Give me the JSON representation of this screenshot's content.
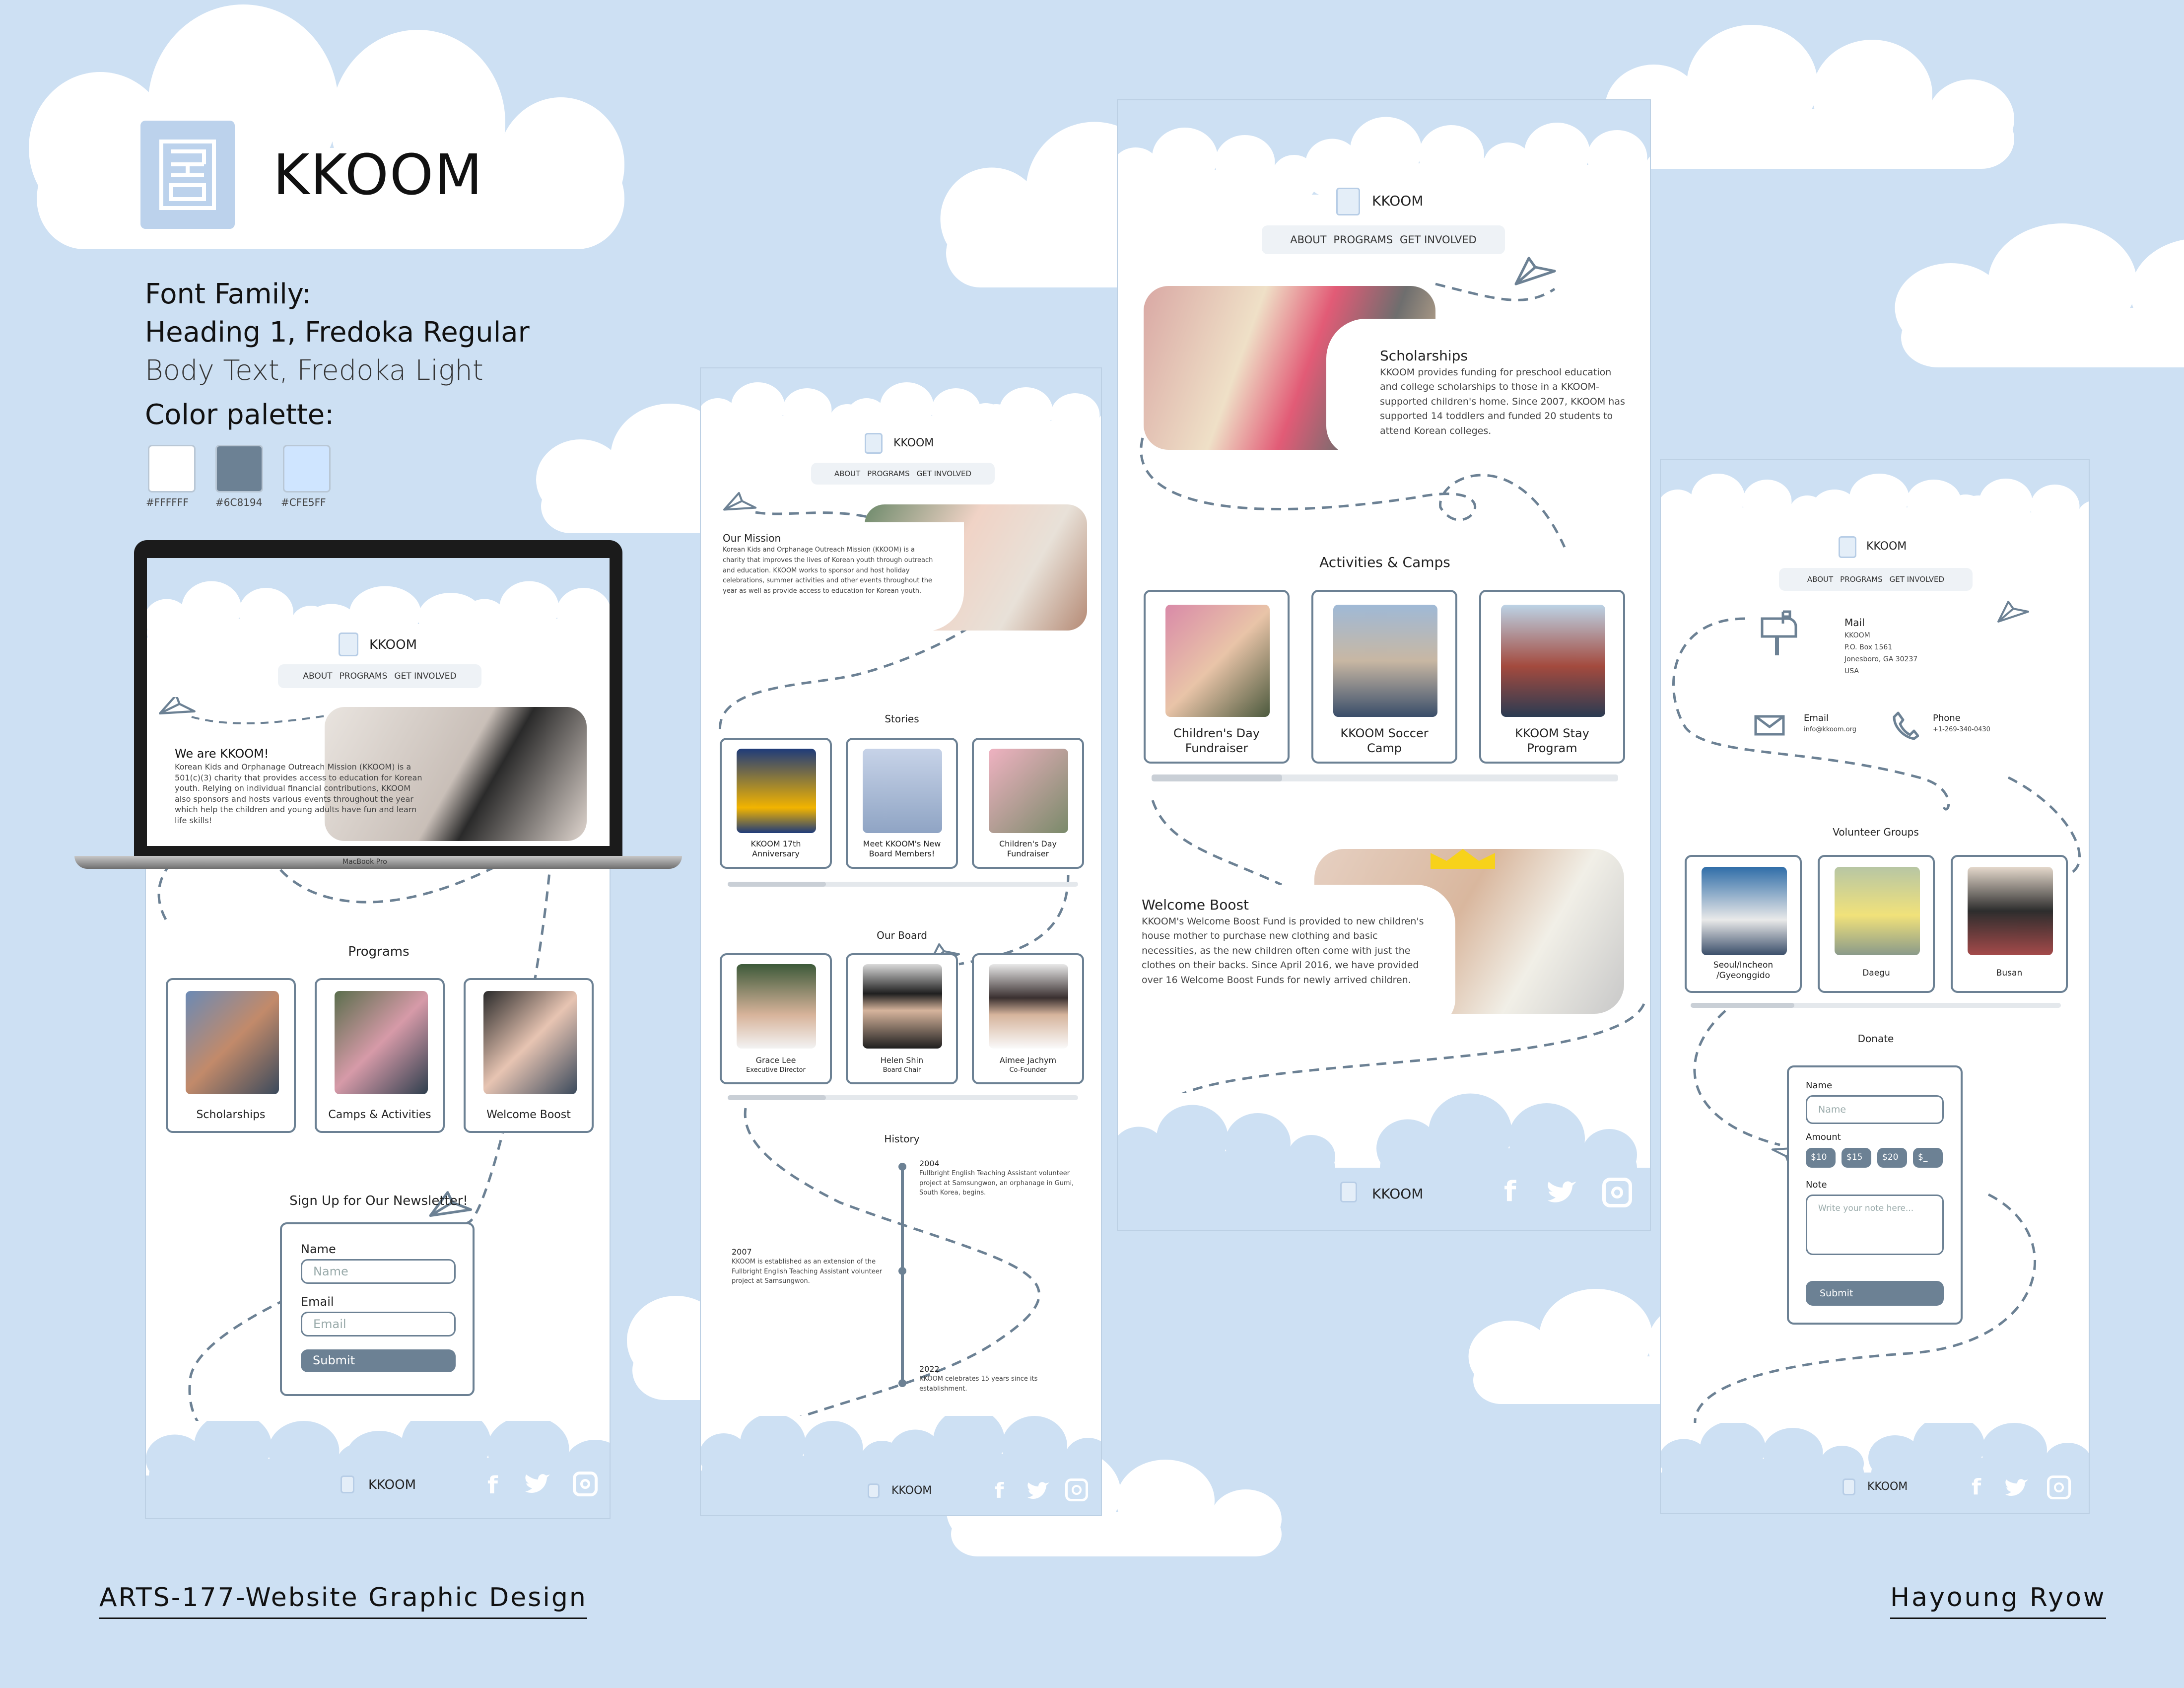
{
  "brand": {
    "name": "KKOOM"
  },
  "style_guide": {
    "font_family_label": "Font Family:",
    "heading_line": "Heading 1, Fredoka Regular",
    "body_line": "Body Text, Fredoka Light",
    "palette_label": "Color palette:",
    "colors": [
      {
        "hex": "#FFFFFF",
        "label": "#FFFFFF"
      },
      {
        "hex": "#6C8194",
        "label": "#6C8194"
      },
      {
        "hex": "#CFE5FF",
        "label": "#CFE5FF"
      }
    ]
  },
  "nav": {
    "about": "ABOUT",
    "programs": "PROGRAMS",
    "get_involved": "GET INVOLVED"
  },
  "home": {
    "hero_title": "We are KKOOM!",
    "hero_body": "Korean Kids and Orphanage Outreach Mission (KKOOM) is a 501(c)(3) charity that provides access to education for Korean youth. Relying on individual financial contributions, KKOOM also sponsors and hosts various events throughout the year which help the children and young adults have fun and learn life skills!",
    "laptop_label": "MacBook Pro",
    "programs_title": "Programs",
    "programs": [
      "Scholarships",
      "Camps & Activities",
      "Welcome Boost"
    ],
    "newsletter_title": "Sign Up for Our Newsletter!",
    "name_label": "Name",
    "name_placeholder": "Name",
    "email_label": "Email",
    "email_placeholder": "Email",
    "submit": "Submit"
  },
  "about": {
    "mission_title": "Our Mission",
    "mission_body": "Korean Kids and Orphanage Outreach Mission (KKOOM) is a charity that improves the lives of Korean youth through outreach and education. KKOOM works to sponsor and host holiday celebrations, summer activities and other events throughout the year as well as provide access to education for Korean youth.",
    "stories_title": "Stories",
    "stories": [
      "KKOOM 17th Anniversary",
      "Meet KKOOM's New Board Members!",
      "Children's Day Fundraiser"
    ],
    "board_title": "Our Board",
    "board": [
      {
        "name": "Grace Lee",
        "role": "Executive Director"
      },
      {
        "name": "Helen Shin",
        "role": "Board Chair"
      },
      {
        "name": "Aimee Jachym",
        "role": "Co-Founder"
      }
    ],
    "history_title": "History",
    "history": [
      {
        "year": "2004",
        "text": "Fullbright English Teaching Assistant volunteer project at Samsungwon, an orphanage in Gumi, South Korea, begins."
      },
      {
        "year": "2007",
        "text": "KKOOM is established as an extension of the Fullbright English Teaching Assistant volunteer project at Samsungwon."
      },
      {
        "year": "2022",
        "text": "KKOOM celebrates 15 years since its establishment."
      }
    ]
  },
  "programs_page": {
    "scholarships_title": "Scholarships",
    "scholarships_body": "KKOOM provides funding for preschool education and college scholarships to those in a KKOOM-supported children's home. Since 2007, KKOOM has supported 14 toddlers and funded 20 students to attend Korean colleges.",
    "activities_title": "Activities & Camps",
    "activities": [
      "Children's Day Fundraiser",
      "KKOOM Soccer Camp",
      "KKOOM Stay Program"
    ],
    "welcome_title": "Welcome Boost",
    "welcome_body": "KKOOM's Welcome Boost Fund is provided to new children's house mother to purchase new clothing and basic necessities, as the new children often come with just the clothes on their backs. Since April 2016, we have provided over 16 Welcome Boost Funds for newly arrived children."
  },
  "involved": {
    "mail_title": "Mail",
    "mail_lines": [
      "KKOOM",
      "P.O. Box 1561",
      "Jonesboro, GA 30237",
      "USA"
    ],
    "email_title": "Email",
    "email_value": "info@kkoom.org",
    "phone_title": "Phone",
    "phone_value": "+1-269-340-0430",
    "volunteer_title": "Volunteer Groups",
    "groups": [
      "Seoul/Incheon /Gyeonggido",
      "Daegu",
      "Busan"
    ],
    "donate_title": "Donate",
    "name_label": "Name",
    "name_placeholder": "Name",
    "amount_label": "Amount",
    "amounts": [
      "$10",
      "$15",
      "$20",
      "$_"
    ],
    "note_label": "Note",
    "note_placeholder": "Write your note here...",
    "submit": "Submit"
  },
  "footer": {
    "course": "ARTS-177-Website Graphic Design",
    "author": "Hayoung Ryow"
  }
}
